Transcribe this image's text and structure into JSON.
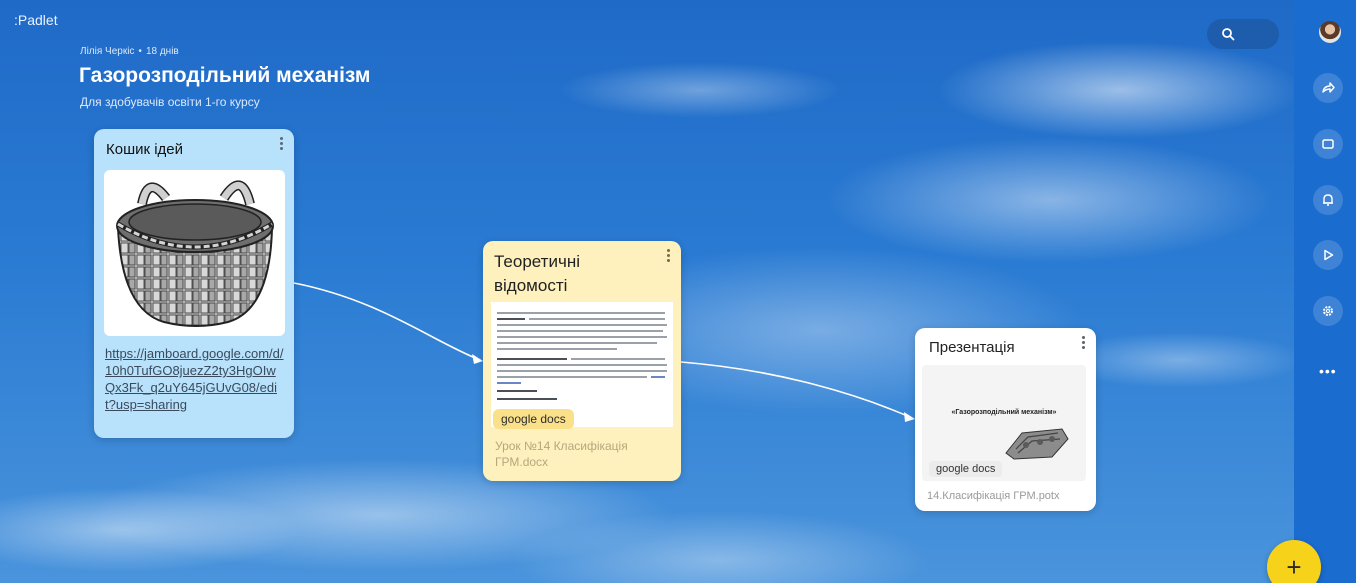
{
  "app": {
    "logo": ":Padlet"
  },
  "board": {
    "author": "Лілія Черкіс",
    "age": "18 днів",
    "title": "Газорозподільний механізм",
    "subtitle": "Для здобувачів освіти 1-го курсу"
  },
  "cards": {
    "ideas": {
      "title": "Кошик ідей",
      "link": "https://jamboard.google.com/d/10h0TufGO8juezZ2ty3HgOIwQx3Fk_q2uY645jGUvG08/edit?usp=sharing"
    },
    "theory": {
      "title": "Теоретичні відомості",
      "badge": "google docs",
      "filename": "Урок №14 Класифікація ГРМ.docx"
    },
    "presentation": {
      "title": "Презентація",
      "slide_title": "«Газорозподільний механізм»",
      "badge": "google docs",
      "filename": "14.Класифікація ГРМ.potx"
    }
  },
  "toolbar": {
    "add_label": "+",
    "more_label": "•••"
  },
  "colors": {
    "sidebar": "#1a6ccf",
    "fab": "#f7d21b",
    "ideas_card": "#b8e2fb",
    "theory_card": "#fef1bd"
  },
  "icons": [
    "search-icon",
    "share-icon",
    "remake-icon",
    "bell-icon",
    "play-icon",
    "gear-icon",
    "more-icon",
    "plus-icon"
  ]
}
